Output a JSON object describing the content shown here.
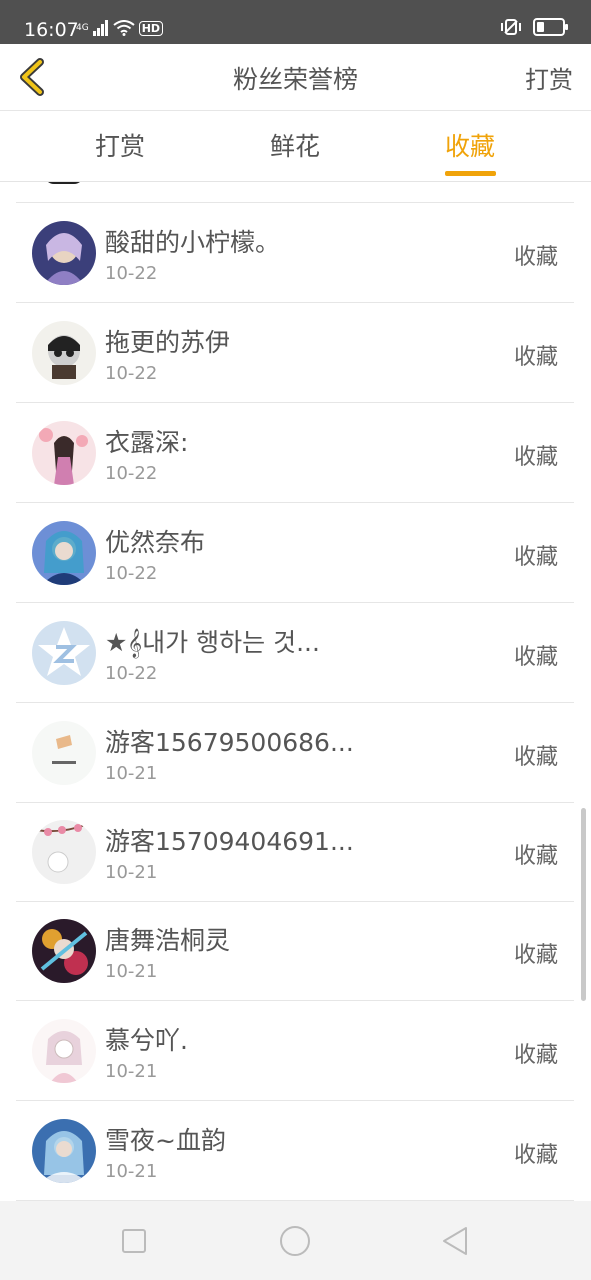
{
  "status_bar": {
    "time": "16:07",
    "network": "4G",
    "hd_label": "HD",
    "battery_level": 0.3
  },
  "header": {
    "title": "粉丝荣誉榜",
    "action_label": "打赏"
  },
  "tabs": [
    {
      "label": "打赏",
      "active": false
    },
    {
      "label": "鲜花",
      "active": false
    },
    {
      "label": "收藏",
      "active": true
    }
  ],
  "accent_color": "#f0a30a",
  "list": [
    {
      "name": "酸甜的小柠檬。",
      "date": "10-22",
      "action": "收藏"
    },
    {
      "name": "拖更的苏伊",
      "date": "10-22",
      "action": "收藏"
    },
    {
      "name": "衣露深:",
      "date": "10-22",
      "action": "收藏"
    },
    {
      "name": "优然奈布",
      "date": "10-22",
      "action": "收藏"
    },
    {
      "name": "★𝄞내가 행하는 것...",
      "date": "10-22",
      "action": "收藏"
    },
    {
      "name": "游客15679500686...",
      "date": "10-21",
      "action": "收藏"
    },
    {
      "name": "游客15709404691...",
      "date": "10-21",
      "action": "收藏"
    },
    {
      "name": "唐舞浩桐灵",
      "date": "10-21",
      "action": "收藏"
    },
    {
      "name": "慕兮吖.",
      "date": "10-21",
      "action": "收藏"
    },
    {
      "name": "雪夜~血韵",
      "date": "10-21",
      "action": "收藏"
    }
  ]
}
